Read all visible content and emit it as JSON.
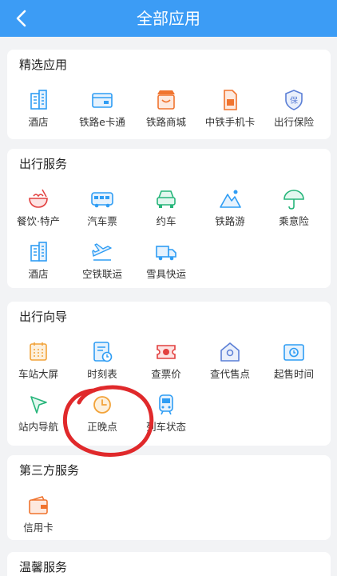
{
  "header": {
    "title": "全部应用"
  },
  "sections": [
    {
      "title": "精选应用",
      "items": [
        {
          "label": "酒店",
          "icon": "hotel-icon"
        },
        {
          "label": "铁路e卡通",
          "icon": "card-icon"
        },
        {
          "label": "铁路商城",
          "icon": "shop-icon"
        },
        {
          "label": "中铁手机卡",
          "icon": "sim-icon"
        },
        {
          "label": "出行保险",
          "icon": "insurance-icon"
        }
      ]
    },
    {
      "title": "出行服务",
      "items": [
        {
          "label": "餐饮·特产",
          "icon": "food-icon"
        },
        {
          "label": "汽车票",
          "icon": "bus-icon"
        },
        {
          "label": "约车",
          "icon": "car-icon"
        },
        {
          "label": "铁路游",
          "icon": "mountain-icon"
        },
        {
          "label": "乘意险",
          "icon": "umbrella-icon"
        },
        {
          "label": "酒店",
          "icon": "hotel-icon"
        },
        {
          "label": "空铁联运",
          "icon": "plane-icon"
        },
        {
          "label": "雪具快运",
          "icon": "truck-icon"
        }
      ]
    },
    {
      "title": "出行向导",
      "items": [
        {
          "label": "车站大屏",
          "icon": "screen-icon"
        },
        {
          "label": "时刻表",
          "icon": "timetable-icon"
        },
        {
          "label": "查票价",
          "icon": "ticket-price-icon"
        },
        {
          "label": "查代售点",
          "icon": "agency-icon"
        },
        {
          "label": "起售时间",
          "icon": "sale-time-icon"
        },
        {
          "label": "站内导航",
          "icon": "navigation-icon"
        },
        {
          "label": "正晚点",
          "icon": "clock-icon"
        },
        {
          "label": "列车状态",
          "icon": "train-icon"
        }
      ]
    },
    {
      "title": "第三方服务",
      "items": [
        {
          "label": "信用卡",
          "icon": "wallet-icon"
        }
      ]
    },
    {
      "title": "温馨服务",
      "items": []
    }
  ],
  "colors": {
    "header": "#3c9cf5",
    "accent": "#2f9df4",
    "annotation": "#e0292b"
  }
}
